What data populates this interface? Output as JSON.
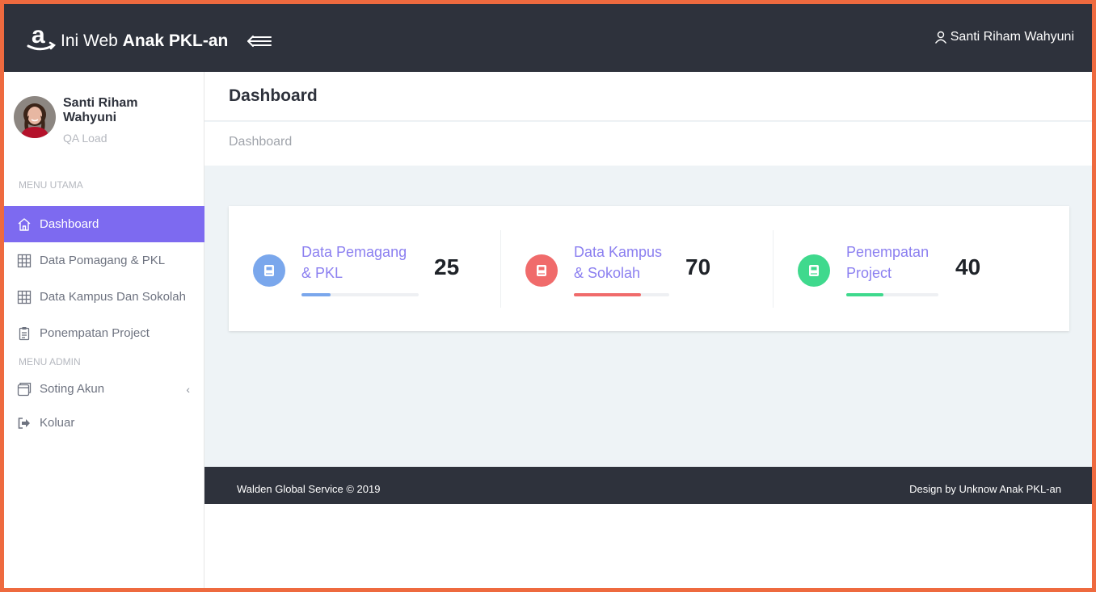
{
  "brand": {
    "prefix": "Ini Web",
    "bold": "Anak PKL-an"
  },
  "header": {
    "user_name": "Santi Riham Wahyuni"
  },
  "profile": {
    "name": "Santi Riham Wahyuni",
    "role": "QA Load"
  },
  "sidebar": {
    "section_main": "MENU UTAMA",
    "section_admin": "MENU ADMIN",
    "items": [
      {
        "label": "Dashboard",
        "icon": "home-icon",
        "active": true
      },
      {
        "label": "Data Pomagang & PKL",
        "icon": "table-icon"
      },
      {
        "label": "Data Kampus Dan Sokolah",
        "icon": "table-icon"
      },
      {
        "label": "Ponempatan Project",
        "icon": "clipboard-icon"
      },
      {
        "label": "Soting Akun",
        "icon": "window-icon"
      },
      {
        "label": "Koluar",
        "icon": "logout-icon"
      }
    ]
  },
  "page": {
    "title": "Dashboard",
    "breadcrumb": "Dashboard"
  },
  "stats": [
    {
      "label_line1": "Data Pemagang",
      "label_line2": "& PKL",
      "value": "25",
      "color": "#7aa7ec",
      "progress": 0.25
    },
    {
      "label_line1": "Data Kampus",
      "label_line2": "& Sokolah",
      "value": "70",
      "color": "#f06b6b",
      "progress": 0.7
    },
    {
      "label_line1": "Penempatan",
      "label_line2": "Project",
      "value": "40",
      "color": "#3fd98d",
      "progress": 0.4
    }
  ],
  "footer": {
    "left": "Walden Global Service © 2019",
    "right": "Design by Unknow Anak PKL-an"
  },
  "colors": {
    "topbar": "#2e323c",
    "accent": "#7d6af0",
    "border": "#ee6a3f"
  }
}
